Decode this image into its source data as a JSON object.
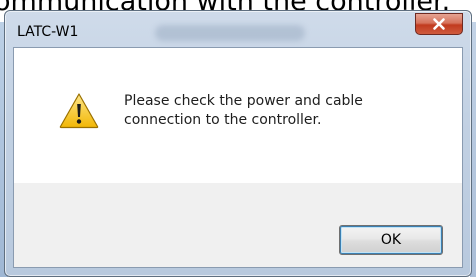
{
  "background": {
    "caption": "ommunication with the controller."
  },
  "dialog": {
    "title": "LATC-W1",
    "message_lines": [
      "Please check the power and cable",
      "connection to the controller."
    ],
    "ok_label": "OK",
    "close_icon": "close-icon",
    "message_icon": "warning-icon"
  },
  "colors": {
    "close_button": "#c94a2e",
    "warning_fill": "#f5c518",
    "frame": "#c2d1e3"
  }
}
